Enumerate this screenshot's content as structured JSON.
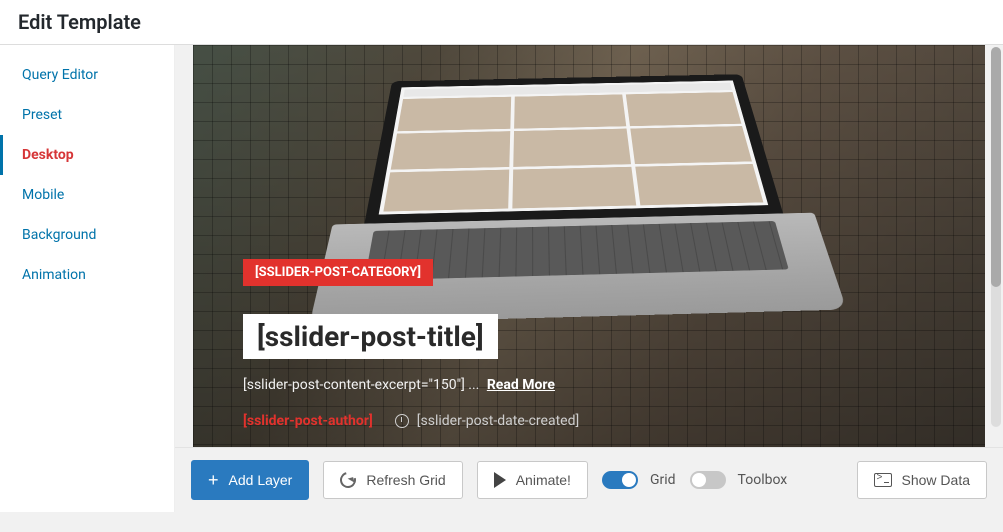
{
  "header": {
    "title": "Edit Template"
  },
  "sidebar": {
    "items": [
      {
        "label": "Query Editor"
      },
      {
        "label": "Preset"
      },
      {
        "label": "Desktop"
      },
      {
        "label": "Mobile"
      },
      {
        "label": "Background"
      },
      {
        "label": "Animation"
      }
    ],
    "active_index": 2
  },
  "canvas": {
    "category_layer": "[SSLIDER-POST-CATEGORY]",
    "title_layer": "[sslider-post-title]",
    "excerpt_layer": "[sslider-post-content-excerpt=\"150\"] ...",
    "read_more": "Read More",
    "author_layer": "[sslider-post-author]",
    "date_layer": "[sslider-post-date-created]"
  },
  "toolbar": {
    "add_layer": "Add Layer",
    "refresh_grid": "Refresh Grid",
    "animate": "Animate!",
    "grid_label": "Grid",
    "grid_on": true,
    "toolbox_label": "Toolbox",
    "toolbox_on": false,
    "show_data": "Show Data"
  }
}
